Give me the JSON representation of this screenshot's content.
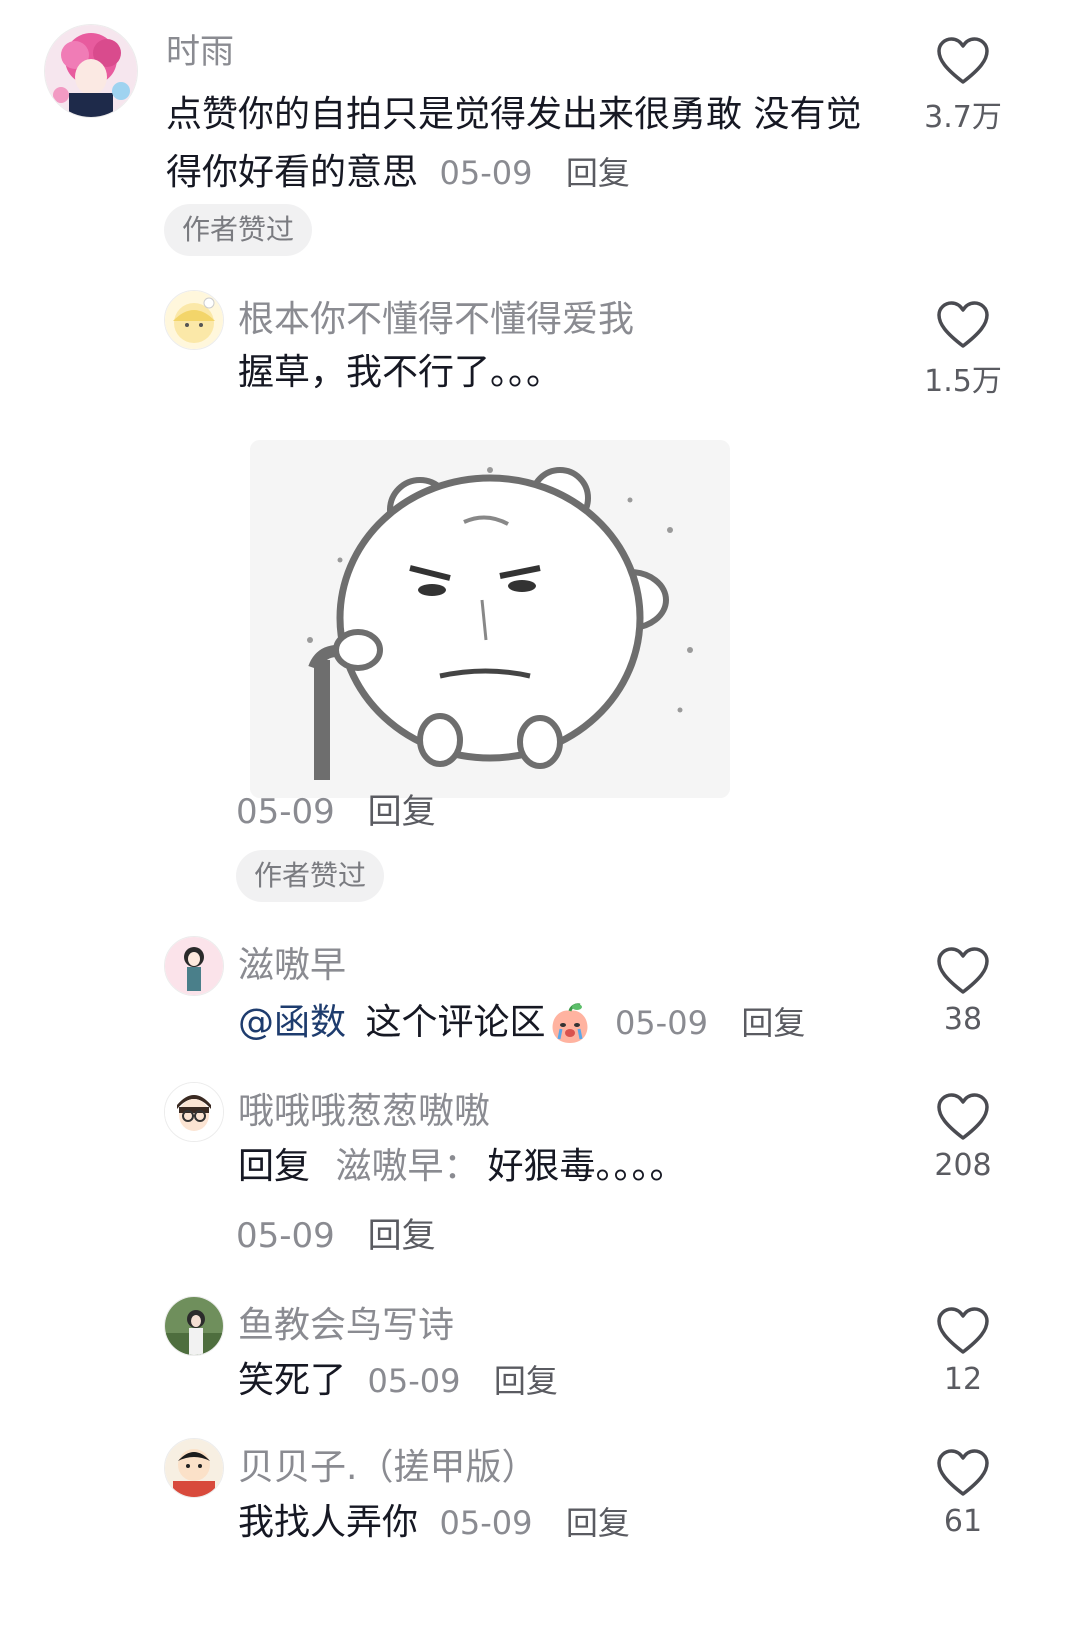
{
  "comments": [
    {
      "user": "时雨",
      "text": "点赞你的自拍只是觉得发出来很勇敢 没有觉得你好看的意思",
      "time": "05-09",
      "reply_label": "回复",
      "likes": "3.7万",
      "badge": "作者赞过"
    },
    {
      "user": "根本你不懂得不懂得爱我",
      "text": "握草，我不行了。。。",
      "time": "05-09",
      "reply_label": "回复",
      "likes": "1.5万",
      "badge": "作者赞过"
    },
    {
      "user": "滋嗷早",
      "mention": "@函数",
      "text": "这个评论区",
      "emoji": "crying-peach-emoji",
      "time": "05-09",
      "reply_label": "回复",
      "likes": "38"
    },
    {
      "user": "哦哦哦葱葱嗷嗷",
      "reply_prefix": "回复",
      "reply_target": "滋嗷早：",
      "text": "好狠毒。。。。",
      "time": "05-09",
      "reply_label": "回复",
      "likes": "208"
    },
    {
      "user": "鱼教会鸟写诗",
      "text": "笑死了",
      "time": "05-09",
      "reply_label": "回复",
      "likes": "12"
    },
    {
      "user": "贝贝子.（搓甲版）",
      "text": "我找人弄你",
      "time": "05-09",
      "reply_label": "回复",
      "likes": "61"
    }
  ],
  "icons": {
    "like": "heart-outline-icon",
    "sticker": "bear-cane-sticker"
  },
  "colors": {
    "username": "#8a8b91",
    "text": "#161823",
    "mention": "#1e3c6e",
    "badge_bg": "#f1f1f2"
  }
}
